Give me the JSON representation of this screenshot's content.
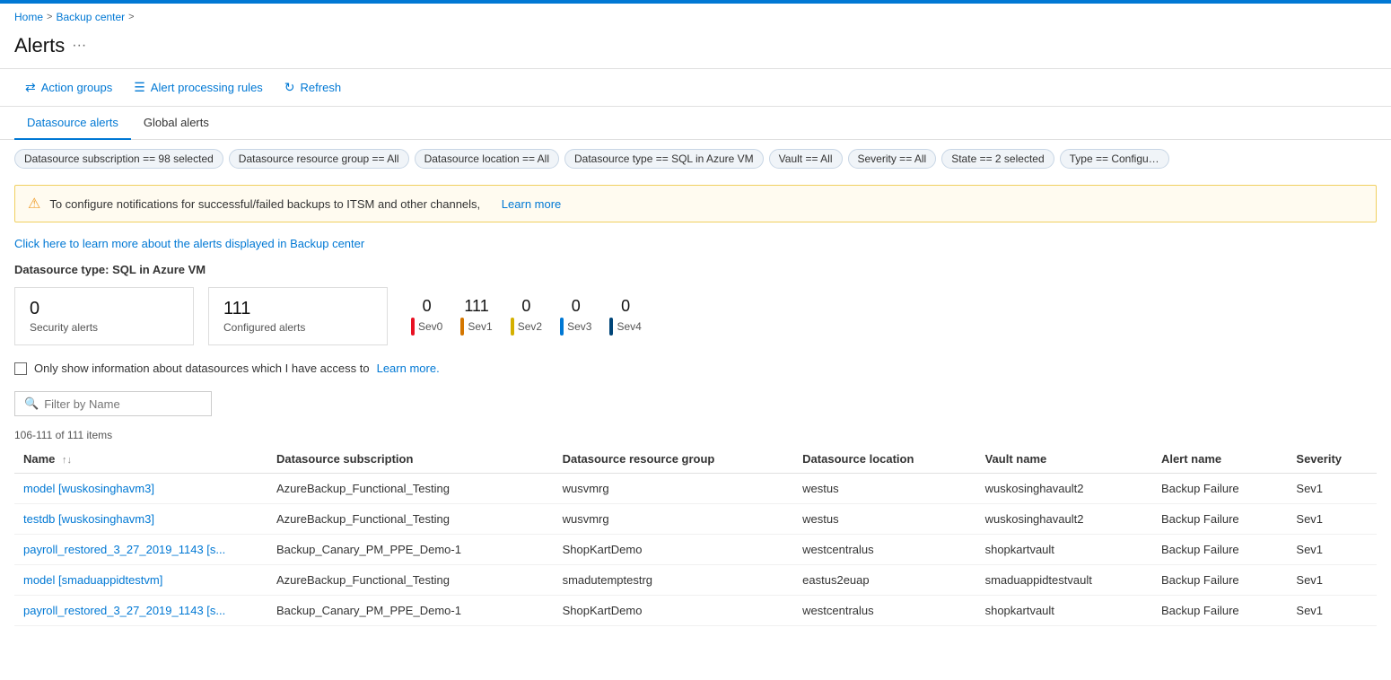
{
  "app": {
    "top_border_color": "#0078d4"
  },
  "breadcrumb": {
    "items": [
      "Home",
      "Backup center"
    ],
    "separators": [
      ">",
      ">"
    ]
  },
  "page": {
    "title": "Alerts",
    "menu_icon": "···"
  },
  "toolbar": {
    "buttons": [
      {
        "id": "action-groups",
        "label": "Action groups",
        "icon": "⇄"
      },
      {
        "id": "alert-processing-rules",
        "label": "Alert processing rules",
        "icon": "☰"
      },
      {
        "id": "refresh",
        "label": "Refresh",
        "icon": "↻"
      }
    ]
  },
  "tabs": [
    {
      "id": "datasource-alerts",
      "label": "Datasource alerts",
      "active": true
    },
    {
      "id": "global-alerts",
      "label": "Global alerts",
      "active": false
    }
  ],
  "filters": [
    {
      "id": "subscription",
      "text": "Datasource subscription == 98 selected"
    },
    {
      "id": "resource-group",
      "text": "Datasource resource group == All"
    },
    {
      "id": "location",
      "text": "Datasource location == All"
    },
    {
      "id": "datasource-type",
      "text": "Datasource type == SQL in Azure VM"
    },
    {
      "id": "vault",
      "text": "Vault == All"
    },
    {
      "id": "severity",
      "text": "Severity == All"
    },
    {
      "id": "state",
      "text": "State == 2 selected"
    },
    {
      "id": "type",
      "text": "Type == Configu…"
    }
  ],
  "warning": {
    "text": "To configure notifications for successful/failed backups to ITSM and other channels,",
    "link_text": "Learn more",
    "link_url": "#"
  },
  "info_link": {
    "text": "Click here to learn more about the alerts displayed in Backup center"
  },
  "datasource_type_label": "Datasource type: SQL in Azure VM",
  "metrics": {
    "cards": [
      {
        "id": "security-alerts",
        "num": "0",
        "label": "Security alerts"
      },
      {
        "id": "configured-alerts",
        "num": "111",
        "label": "Configured alerts"
      }
    ],
    "severities": [
      {
        "id": "sev0",
        "num": "0",
        "label": "Sev0",
        "class": "sev0"
      },
      {
        "id": "sev1",
        "num": "111",
        "label": "Sev1",
        "class": "sev1"
      },
      {
        "id": "sev2",
        "num": "0",
        "label": "Sev2",
        "class": "sev2"
      },
      {
        "id": "sev3",
        "num": "0",
        "label": "Sev3",
        "class": "sev3"
      },
      {
        "id": "sev4",
        "num": "0",
        "label": "Sev4",
        "class": "sev4"
      }
    ]
  },
  "only_show": {
    "text": "Only show information about datasources which I have access to",
    "link_text": "Learn more."
  },
  "filter_input": {
    "placeholder": "Filter by Name"
  },
  "item_count": "106-111 of 111 items",
  "table": {
    "columns": [
      {
        "id": "name",
        "label": "Name",
        "sortable": true
      },
      {
        "id": "subscription",
        "label": "Datasource subscription",
        "sortable": false
      },
      {
        "id": "resource-group",
        "label": "Datasource resource group",
        "sortable": false
      },
      {
        "id": "location",
        "label": "Datasource location",
        "sortable": false
      },
      {
        "id": "vault-name",
        "label": "Vault name",
        "sortable": false
      },
      {
        "id": "alert-name",
        "label": "Alert name",
        "sortable": false
      },
      {
        "id": "severity",
        "label": "Severity",
        "sortable": false
      }
    ],
    "rows": [
      {
        "name": "model [wuskosinghavm3]",
        "subscription": "AzureBackup_Functional_Testing",
        "resource_group": "wusvmrg",
        "location": "westus",
        "vault_name": "wuskosinghavault2",
        "alert_name": "Backup Failure",
        "severity": "Sev1"
      },
      {
        "name": "testdb [wuskosinghavm3]",
        "subscription": "AzureBackup_Functional_Testing",
        "resource_group": "wusvmrg",
        "location": "westus",
        "vault_name": "wuskosinghavault2",
        "alert_name": "Backup Failure",
        "severity": "Sev1"
      },
      {
        "name": "payroll_restored_3_27_2019_1143 [s...",
        "subscription": "Backup_Canary_PM_PPE_Demo-1",
        "resource_group": "ShopKartDemo",
        "location": "westcentralus",
        "vault_name": "shopkartvault",
        "alert_name": "Backup Failure",
        "severity": "Sev1"
      },
      {
        "name": "model [smaduappidtestvm]",
        "subscription": "AzureBackup_Functional_Testing",
        "resource_group": "smadutemptestrg",
        "location": "eastus2euap",
        "vault_name": "smaduappidtestvault",
        "alert_name": "Backup Failure",
        "severity": "Sev1"
      },
      {
        "name": "payroll_restored_3_27_2019_1143 [s...",
        "subscription": "Backup_Canary_PM_PPE_Demo-1",
        "resource_group": "ShopKartDemo",
        "location": "westcentralus",
        "vault_name": "shopkartvault",
        "alert_name": "Backup Failure",
        "severity": "Sev1"
      }
    ]
  }
}
